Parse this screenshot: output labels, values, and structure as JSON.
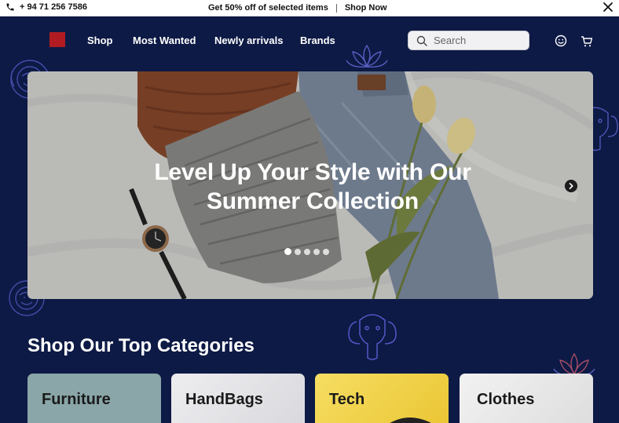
{
  "topbar": {
    "phone": "+ 94 71 256 7586",
    "promo_text": "Get 50% off of selected items",
    "shop_now": "Shop Now"
  },
  "nav": {
    "links": [
      "Shop",
      "Most Wanted",
      "Newly arrivals",
      "Brands"
    ],
    "search_placeholder": "Search"
  },
  "hero": {
    "headline_line1": "Level Up Your Style with Our",
    "headline_line2": "Summer Collection",
    "slide_count": 5,
    "active_slide": 1
  },
  "categories": {
    "title": "Shop Our Top Categories",
    "items": [
      "Furniture",
      "HandBags",
      "Tech",
      "Clothes"
    ]
  },
  "colors": {
    "page_background": "#0d1a45",
    "brand_red": "#b01c22",
    "card_furniture": "#8aa6a8",
    "card_handbags": "#e9e9ec",
    "card_tech": "#f2d34a",
    "card_clothes": "#ebebeb"
  },
  "icons": [
    "phone-icon",
    "close-icon",
    "search-icon",
    "user-icon",
    "cart-icon",
    "chevron-right-icon",
    "lion-icon",
    "lotus-icon",
    "elephant-icon"
  ]
}
